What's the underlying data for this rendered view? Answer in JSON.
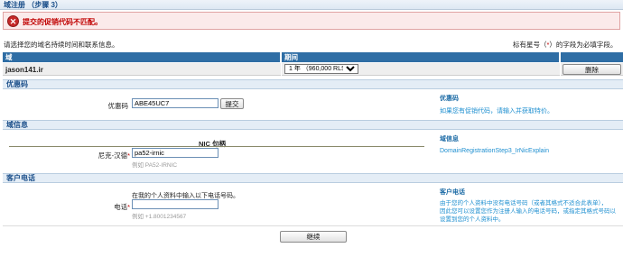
{
  "header": {
    "title": "域注册 （步骤 3）"
  },
  "error": {
    "icon": "error-x-icon",
    "message": "提交的促销代码不匹配。"
  },
  "intro": {
    "instructions": "请选择您的域名持续时间和联系信息。",
    "required_prefix": "标有星号（",
    "required_star": "*",
    "required_suffix": "）的字段为必填字段。"
  },
  "domain_table": {
    "col_domain": "域",
    "col_period": "期间",
    "domain": "jason141.ir",
    "period_selected": "1 年 （960,000 RLS）",
    "remove_label": "删除"
  },
  "promo": {
    "section_title": "优惠码",
    "label": "优惠码",
    "value": "ABE45UC7",
    "submit_label": "提交",
    "help_title": "优惠码",
    "help_text": "如果您有促销代码，请输入并获取特价。"
  },
  "domain_info": {
    "section_title": "域信息",
    "nic_title": "NIC 句柄",
    "nic_label": "尼克-汉德",
    "nic_value": "pa52-irnic",
    "nic_hint": "例如 PA52-IRNIC",
    "help_title": "域信息",
    "help_text": "DomainRegistrationStep3_IrNicExplain"
  },
  "phone": {
    "section_title": "客户电话",
    "note": "在我的个人资料中输入以下电话号码。",
    "label": "电话",
    "value": "",
    "hint": "例如 +1.8001234567",
    "help_title": "客户电话",
    "help_text_1": "由于您的个人资料中没有电话号码（或者其格式不适合此表单），",
    "help_text_2": "因此您可以设置您作为注册人输入的电话号码，或指定其格式号码以",
    "help_text_3": "设置到您的个人资料中。"
  },
  "footer": {
    "continue_label": "继续"
  },
  "colors": {
    "accent": "#2f6ea5",
    "error": "#c00000",
    "link": "#1e8fd0"
  }
}
